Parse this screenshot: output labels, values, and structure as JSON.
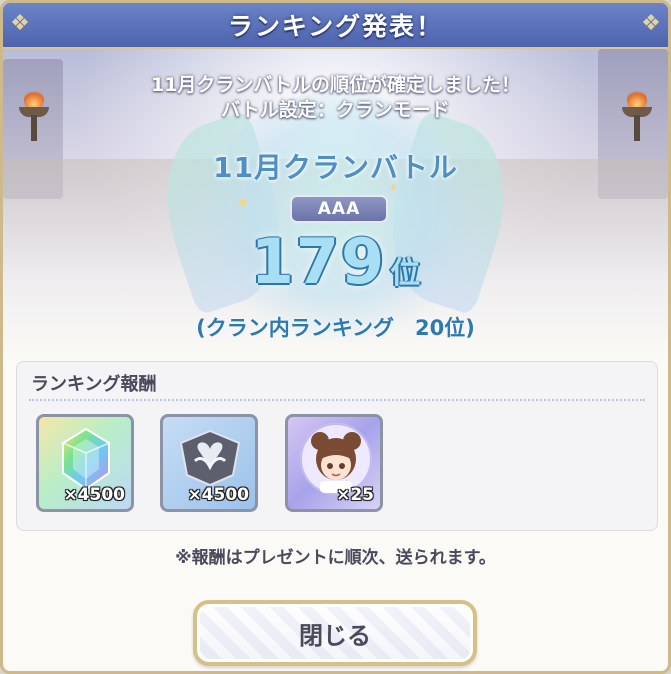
{
  "dialog": {
    "title": "ランキング発表！",
    "info_line1": "11月クランバトルの順位が確定しました！",
    "info_line2": "バトル設定：クランモード",
    "battle_name": "11月クランバトル",
    "grade": "AAA",
    "rank_number": "179",
    "rank_unit": "位",
    "clan_rank": "(クラン内ランキング　20位)"
  },
  "rewards": {
    "title": "ランキング報酬",
    "items": [
      {
        "icon": "rainbow-gem-icon",
        "qty": "×4500"
      },
      {
        "icon": "silver-heart-stone-icon",
        "qty": "×4500"
      },
      {
        "icon": "character-portrait-icon",
        "qty": "×25"
      }
    ]
  },
  "notice": "※報酬はプレゼントに順次、送られます。",
  "close_button": {
    "label": "閉じる"
  },
  "colors": {
    "title_bar": "#5a70b8",
    "rank_text": "#a8dff5",
    "rank_outline": "#2f76a8",
    "clan_rank_text": "#2c7ab3",
    "button_border": "#d5c187"
  }
}
